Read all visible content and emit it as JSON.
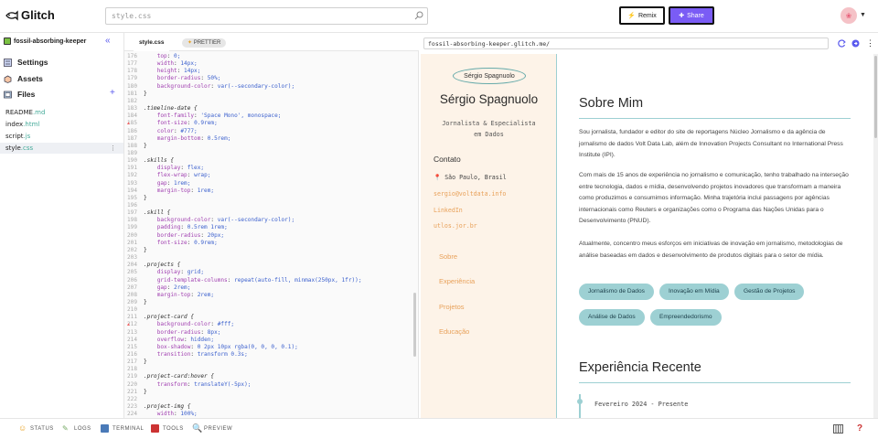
{
  "app": {
    "logo_text": "Glitch",
    "search_placeholder": "style.css",
    "remix_label": "Remix",
    "share_label": "Share",
    "accent_color": "#7a5cf5"
  },
  "sidebar": {
    "project_name": "fossil-absorbing-keeper",
    "nav": [
      {
        "label": "Settings",
        "icon": "settings-icon"
      },
      {
        "label": "Assets",
        "icon": "assets-icon"
      },
      {
        "label": "Files",
        "icon": "files-icon"
      }
    ],
    "files": [
      {
        "base": "README",
        "ext": ".md"
      },
      {
        "base": "index",
        "ext": ".html"
      },
      {
        "base": "script",
        "ext": ".js"
      },
      {
        "base": "style",
        "ext": ".css",
        "active": true
      }
    ]
  },
  "editor": {
    "tab_label": "style.css",
    "prettier_label": "PRETTIER",
    "lines": [
      {
        "n": "176",
        "text": "    top: 0;"
      },
      {
        "n": "177",
        "text": "    width: 14px;"
      },
      {
        "n": "178",
        "text": "    height: 14px;"
      },
      {
        "n": "179",
        "text": "    border-radius: 50%;"
      },
      {
        "n": "180",
        "text": "    background-color: var(--secondary-color);"
      },
      {
        "n": "181",
        "text": "}"
      },
      {
        "n": "182",
        "text": ""
      },
      {
        "n": "183",
        "text": ".timeline-date {"
      },
      {
        "n": "184",
        "text": "    font-family: 'Space Mono', monospace;"
      },
      {
        "n": "185",
        "text": "    font-size: 0.9rem;"
      },
      {
        "n": "186",
        "text": "    color: #777;"
      },
      {
        "n": "187",
        "text": "    margin-bottom: 0.5rem;"
      },
      {
        "n": "188",
        "text": "}"
      },
      {
        "n": "189",
        "text": ""
      },
      {
        "n": "190",
        "text": ".skills {"
      },
      {
        "n": "191",
        "text": "    display: flex;"
      },
      {
        "n": "192",
        "text": "    flex-wrap: wrap;"
      },
      {
        "n": "193",
        "text": "    gap: 1rem;"
      },
      {
        "n": "194",
        "text": "    margin-top: 1rem;"
      },
      {
        "n": "195",
        "text": "}"
      },
      {
        "n": "196",
        "text": ""
      },
      {
        "n": "197",
        "text": ".skill {"
      },
      {
        "n": "198",
        "text": "    background-color: var(--secondary-color);"
      },
      {
        "n": "199",
        "text": "    padding: 0.5rem 1rem;"
      },
      {
        "n": "200",
        "text": "    border-radius: 20px;"
      },
      {
        "n": "201",
        "text": "    font-size: 0.9rem;"
      },
      {
        "n": "202",
        "text": "}"
      },
      {
        "n": "203",
        "text": ""
      },
      {
        "n": "204",
        "text": ".projects {"
      },
      {
        "n": "205",
        "text": "    display: grid;"
      },
      {
        "n": "206",
        "text": "    grid-template-columns: repeat(auto-fill, minmax(250px, 1fr));"
      },
      {
        "n": "207",
        "text": "    gap: 2rem;"
      },
      {
        "n": "208",
        "text": "    margin-top: 2rem;"
      },
      {
        "n": "209",
        "text": "}"
      },
      {
        "n": "210",
        "text": ""
      },
      {
        "n": "211",
        "text": ".project-card {"
      },
      {
        "n": "212",
        "text": "    background-color: #fff;"
      },
      {
        "n": "213",
        "text": "    border-radius: 8px;"
      },
      {
        "n": "214",
        "text": "    overflow: hidden;"
      },
      {
        "n": "215",
        "text": "    box-shadow: 0 2px 10px rgba(0, 0, 0, 0.1);"
      },
      {
        "n": "216",
        "text": "    transition: transform 0.3s;"
      },
      {
        "n": "217",
        "text": "}"
      },
      {
        "n": "218",
        "text": ""
      },
      {
        "n": "219",
        "text": ".project-card:hover {"
      },
      {
        "n": "220",
        "text": "    transform: translateY(-5px);"
      },
      {
        "n": "221",
        "text": "}"
      },
      {
        "n": "222",
        "text": ""
      },
      {
        "n": "223",
        "text": ".project-img {"
      },
      {
        "n": "224",
        "text": "    width: 100%;"
      }
    ]
  },
  "preview": {
    "url": "fossil-absorbing-keeper.glitch.me/",
    "photo_alt": "Sérgio Spagnuolo",
    "name": "Sérgio Spagnuolo",
    "role_line1": "Jornalista & Especialista",
    "role_line2": "em Dados",
    "contact_heading": "Contato",
    "location": "São Paulo, Brasil",
    "email": "sergio@voltdata.info",
    "linkedin": "LinkedIn",
    "site": "utlos.jor.br",
    "nav": [
      "Sobre",
      "Experiência",
      "Projetos",
      "Educação"
    ],
    "about_heading": "Sobre Mim",
    "para1": "Sou jornalista, fundador e editor do site de reportagens Núcleo Jornalismo e da agência de jornalismo de dados Volt Data Lab, além de Innovation Projects Consultant no International Press Institute (IPI).",
    "para2": "Com mais de 15 anos de experiência no jornalismo e comunicação, tenho trabalhado na interseção entre tecnologia, dados e mídia, desenvolvendo projetos inovadores que transformam a maneira como produzimos e consumimos informação. Minha trajetória inclui passagens por agências internacionais como Reuters e organizações como o Programa das Nações Unidas para o Desenvolvimento (PNUD).",
    "para3": "Atualmente, concentro meus esforços em iniciativas de inovação em jornalismo, metodologias de análise baseadas em dados e desenvolvimento de produtos digitais para o setor de mídia.",
    "skills": [
      "Jornalismo de Dados",
      "Inovação em Mídia",
      "Gestão de Projetos",
      "Análise de Dados",
      "Empreendedorismo"
    ],
    "exp_heading": "Experiência Recente",
    "exp_date": "Fevereiro 2024 - Presente",
    "secondary_color": "#9dd0d3"
  },
  "bottom": {
    "items": [
      "STATUS",
      "LOGS",
      "TERMINAL",
      "TOOLS",
      "PREVIEW"
    ],
    "help_label": "?"
  }
}
